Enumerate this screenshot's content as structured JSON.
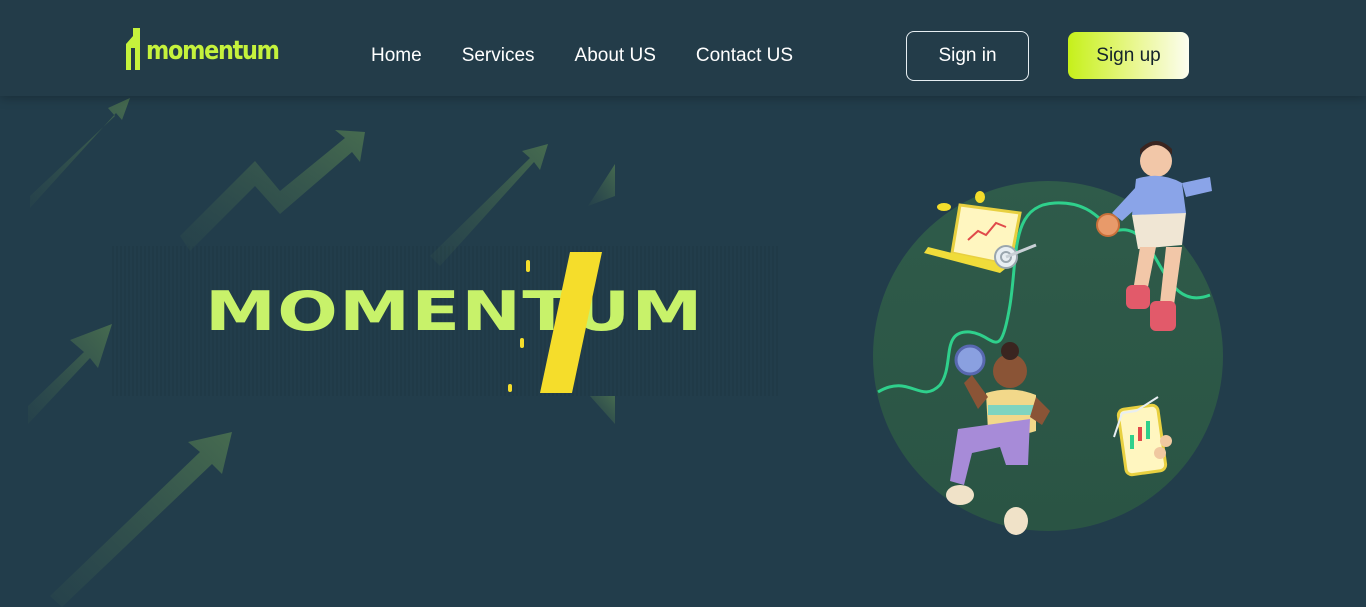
{
  "brand": {
    "logo_text": "momentum",
    "accent": "#c5f23c"
  },
  "nav": {
    "items": [
      {
        "label": "Home"
      },
      {
        "label": "Services"
      },
      {
        "label": "About US"
      },
      {
        "label": "Contact US"
      }
    ]
  },
  "auth": {
    "signin_label": "Sign in",
    "signup_label": "Sign up"
  },
  "hero": {
    "title": "MOMENTUM"
  },
  "colors": {
    "background": "#223d4b",
    "title": "#c8f26a",
    "slash": "#f5dd2b",
    "circle": "#2f5b4a",
    "chart_line": "#2fd08c"
  }
}
